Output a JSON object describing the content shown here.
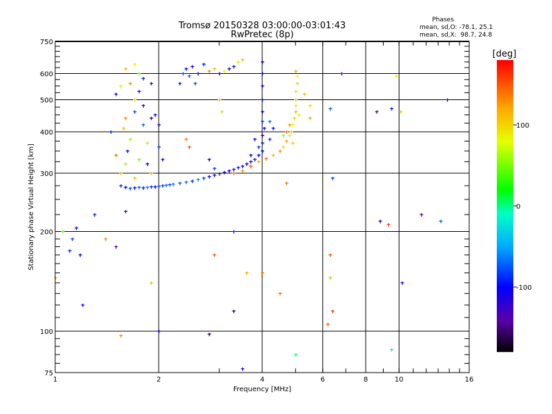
{
  "chart_data": {
    "type": "scatter",
    "title": "Tromsø 20150328 03:00:00-03:01:43",
    "subtitle": "RwPretec (8p)",
    "stats": {
      "heading": "Phases",
      "line_o": "mean, sd,O: -78.1, 25.1",
      "line_x": "mean, sd,X:  98.7, 24.8"
    },
    "xlabel": "Frequency [MHz]",
    "ylabel": "Stationary phase Virtual Height [km]",
    "xscale": "log",
    "yscale": "log",
    "xlim": [
      1,
      16
    ],
    "ylim": [
      75,
      750
    ],
    "xticks": [
      1,
      2,
      4,
      6,
      8,
      10,
      16
    ],
    "yticks": [
      75,
      100,
      200,
      300,
      400,
      500,
      600,
      750
    ],
    "xgrid": [
      2,
      4,
      6,
      8,
      10
    ],
    "ygrid": [
      100,
      200,
      300,
      400,
      500,
      600
    ],
    "colorbar": {
      "label": "[deg]",
      "range": [
        -180,
        180
      ],
      "ticks": [
        100,
        0,
        -100
      ]
    },
    "point_fields": [
      "frequency_mhz",
      "height_km",
      "phase_deg"
    ],
    "points": [
      [
        1.55,
        275,
        -90
      ],
      [
        1.6,
        272,
        -100
      ],
      [
        1.65,
        270,
        -80
      ],
      [
        1.7,
        271,
        -110
      ],
      [
        1.75,
        272,
        -70
      ],
      [
        1.8,
        271,
        -95
      ],
      [
        1.85,
        272,
        -60
      ],
      [
        1.9,
        273,
        -85
      ],
      [
        1.95,
        273,
        -100
      ],
      [
        2.0,
        274,
        -75
      ],
      [
        2.05,
        275,
        -90
      ],
      [
        2.1,
        276,
        -70
      ],
      [
        2.15,
        277,
        -80
      ],
      [
        2.2,
        278,
        -65
      ],
      [
        2.3,
        280,
        -75
      ],
      [
        2.4,
        282,
        -70
      ],
      [
        2.5,
        284,
        -85
      ],
      [
        2.6,
        287,
        -60
      ],
      [
        2.7,
        290,
        -80
      ],
      [
        2.8,
        293,
        -95
      ],
      [
        2.9,
        296,
        -110
      ],
      [
        3.0,
        299,
        -90
      ],
      [
        3.1,
        302,
        -120
      ],
      [
        3.2,
        305,
        -100
      ],
      [
        3.3,
        308,
        -115
      ],
      [
        3.4,
        312,
        -90
      ],
      [
        3.5,
        315,
        -110
      ],
      [
        3.6,
        320,
        -100
      ],
      [
        3.7,
        325,
        -120
      ],
      [
        3.8,
        330,
        -95
      ],
      [
        3.9,
        340,
        -110
      ],
      [
        4.0,
        350,
        -100
      ],
      [
        4.0,
        370,
        -90
      ],
      [
        4.0,
        390,
        -115
      ],
      [
        4.05,
        410,
        -100
      ],
      [
        4.0,
        430,
        -80
      ],
      [
        4.0,
        460,
        -105
      ],
      [
        4.0,
        500,
        -95
      ],
      [
        4.0,
        550,
        -110
      ],
      [
        4.0,
        600,
        -100
      ],
      [
        4.0,
        650,
        -120
      ],
      [
        3.9,
        360,
        -85
      ],
      [
        3.8,
        380,
        -100
      ],
      [
        3.7,
        340,
        -110
      ],
      [
        4.2,
        380,
        -90
      ],
      [
        4.3,
        410,
        -100
      ],
      [
        4.2,
        430,
        -70
      ],
      [
        3.3,
        300,
        140
      ],
      [
        3.5,
        305,
        130
      ],
      [
        3.7,
        315,
        150
      ],
      [
        3.9,
        325,
        120
      ],
      [
        4.1,
        332,
        140
      ],
      [
        4.3,
        340,
        110
      ],
      [
        4.5,
        350,
        130
      ],
      [
        4.6,
        360,
        100
      ],
      [
        4.7,
        375,
        120
      ],
      [
        4.8,
        390,
        90
      ],
      [
        4.85,
        400,
        110
      ],
      [
        4.9,
        420,
        80
      ],
      [
        4.95,
        440,
        100
      ],
      [
        5.0,
        460,
        120
      ],
      [
        5.0,
        480,
        90
      ],
      [
        5.0,
        500,
        110
      ],
      [
        5.0,
        530,
        70
      ],
      [
        5.05,
        560,
        100
      ],
      [
        5.05,
        590,
        80
      ],
      [
        5.0,
        610,
        120
      ],
      [
        4.7,
        400,
        140
      ],
      [
        4.6,
        390,
        60
      ],
      [
        4.8,
        420,
        130
      ],
      [
        4.9,
        370,
        100
      ],
      [
        5.1,
        450,
        90
      ],
      [
        5.3,
        520,
        110
      ],
      [
        5.5,
        480,
        100
      ],
      [
        5.5,
        440,
        120
      ],
      [
        1.55,
        300,
        120
      ],
      [
        1.6,
        320,
        100
      ],
      [
        1.62,
        350,
        -100
      ],
      [
        1.65,
        380,
        60
      ],
      [
        1.58,
        410,
        110
      ],
      [
        1.6,
        440,
        130
      ],
      [
        1.7,
        460,
        -80
      ],
      [
        1.7,
        500,
        100
      ],
      [
        1.75,
        530,
        -110
      ],
      [
        1.65,
        560,
        130
      ],
      [
        1.6,
        620,
        110
      ],
      [
        1.7,
        640,
        80
      ],
      [
        1.75,
        600,
        40
      ],
      [
        1.8,
        580,
        -90
      ],
      [
        1.8,
        480,
        -120
      ],
      [
        1.8,
        420,
        -70
      ],
      [
        1.85,
        370,
        100
      ],
      [
        1.85,
        320,
        -100
      ],
      [
        1.9,
        300,
        120
      ],
      [
        1.75,
        330,
        50
      ],
      [
        1.7,
        290,
        110
      ],
      [
        1.5,
        340,
        140
      ],
      [
        1.45,
        400,
        -90
      ],
      [
        1.5,
        520,
        -100
      ],
      [
        1.55,
        550,
        70
      ],
      [
        1.9,
        560,
        -130
      ],
      [
        1.9,
        440,
        -150
      ],
      [
        1.95,
        450,
        -100
      ],
      [
        2.0,
        420,
        -120
      ],
      [
        2.0,
        360,
        -80
      ],
      [
        2.05,
        330,
        -100
      ],
      [
        2.3,
        560,
        -90
      ],
      [
        2.35,
        600,
        -80
      ],
      [
        2.4,
        620,
        -100
      ],
      [
        2.45,
        590,
        -70
      ],
      [
        2.5,
        630,
        -110
      ],
      [
        2.55,
        560,
        -80
      ],
      [
        2.6,
        600,
        -100
      ],
      [
        2.7,
        640,
        -90
      ],
      [
        2.8,
        610,
        130
      ],
      [
        2.9,
        620,
        110
      ],
      [
        3.0,
        600,
        -100
      ],
      [
        3.1,
        610,
        80
      ],
      [
        3.2,
        620,
        -120
      ],
      [
        3.3,
        630,
        -100
      ],
      [
        3.4,
        650,
        90
      ],
      [
        3.5,
        660,
        110
      ],
      [
        2.4,
        380,
        140
      ],
      [
        2.45,
        360,
        150
      ],
      [
        2.8,
        330,
        -110
      ],
      [
        2.9,
        310,
        -80
      ],
      [
        3.0,
        500,
        110
      ],
      [
        3.05,
        460,
        60
      ],
      [
        1.1,
        175,
        -90
      ],
      [
        1.12,
        190,
        -80
      ],
      [
        1.15,
        205,
        -100
      ],
      [
        1.18,
        170,
        -95
      ],
      [
        1.05,
        200,
        40
      ],
      [
        1.3,
        225,
        -90
      ],
      [
        1.4,
        190,
        130
      ],
      [
        1.2,
        120,
        -120
      ],
      [
        1.0,
        145,
        110
      ],
      [
        1.5,
        180,
        -140
      ],
      [
        1.55,
        97,
        130
      ],
      [
        2.0,
        100,
        -110
      ],
      [
        2.8,
        98,
        -160
      ],
      [
        3.3,
        200,
        -90
      ],
      [
        3.5,
        77,
        -120
      ],
      [
        3.6,
        150,
        120
      ],
      [
        4.0,
        150,
        140
      ],
      [
        6.3,
        170,
        150
      ],
      [
        6.3,
        145,
        110
      ],
      [
        6.4,
        115,
        160
      ],
      [
        6.2,
        105,
        150
      ],
      [
        6.4,
        290,
        -80
      ],
      [
        6.3,
        470,
        -70
      ],
      [
        6.8,
        600,
        -140
      ],
      [
        8.6,
        460,
        -150
      ],
      [
        8.8,
        215,
        -110
      ],
      [
        9.3,
        210,
        160
      ],
      [
        9.5,
        470,
        -90
      ],
      [
        9.8,
        590,
        90
      ],
      [
        10.1,
        460,
        110
      ],
      [
        10.2,
        140,
        -110
      ],
      [
        11.6,
        225,
        -140
      ],
      [
        13.2,
        215,
        -70
      ],
      [
        13.8,
        500,
        -150
      ],
      [
        9.5,
        88,
        0
      ],
      [
        5.0,
        85,
        0
      ],
      [
        3.3,
        115,
        -160
      ],
      [
        2.9,
        170,
        150
      ],
      [
        1.6,
        230,
        -150
      ],
      [
        1.9,
        140,
        110
      ],
      [
        4.5,
        130,
        140
      ],
      [
        4.7,
        280,
        140
      ]
    ]
  }
}
